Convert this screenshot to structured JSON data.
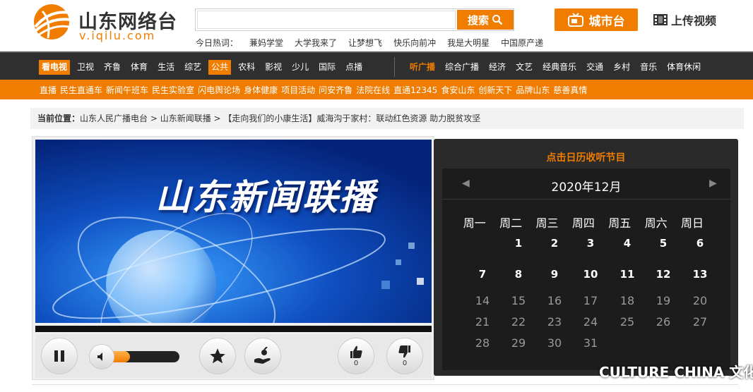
{
  "header": {
    "logo_title": "山东网络台",
    "logo_url": "v.iqilu.com",
    "search_placeholder": "",
    "search_label": "搜索",
    "hot_label": "今日热词：",
    "hot_words": [
      "蒹妈学堂",
      "大学我来了",
      "让梦想飞",
      "快乐向前冲",
      "我是大明星",
      "中国原产递"
    ],
    "city_label": "城市台",
    "upload_label": "上传视频"
  },
  "nav": {
    "tv_label": "看电视",
    "tv_items": [
      "卫视",
      "齐鲁",
      "体育",
      "生活",
      "综艺",
      "公共",
      "农科",
      "影视",
      "少儿",
      "国际",
      "点播"
    ],
    "radio_label": "听广播",
    "radio_items": [
      "综合广播",
      "经济",
      "文艺",
      "经典音乐",
      "交通",
      "乡村",
      "音乐",
      "体育休闲"
    ]
  },
  "subnav": {
    "items": [
      "直播",
      "民生直通车",
      "新闻午班车",
      "民生实验室",
      "闪电舆论场",
      "身体健康",
      "项目活动",
      "问安齐鲁",
      "法院在线",
      "直通12345",
      "食安山东",
      "创新天下",
      "品牌山东",
      "慈善真情"
    ]
  },
  "breadcrumb": {
    "label": "当前位置：",
    "path": "山东人民广播电台 > 山东新闻联播 > 【走向我们的小康生活】威海沟于家村：联动红色资源 助力脱贫攻坚"
  },
  "player": {
    "video_title": "山东新闻联播",
    "volume": 0.3,
    "likes": "0",
    "dislikes": "0"
  },
  "calendar": {
    "heading": "点击日历收听节目",
    "month": "2020年12月",
    "weekdays": [
      "周一",
      "周二",
      "周三",
      "周四",
      "周五",
      "周六",
      "周日"
    ],
    "days_active": [
      "1",
      "2",
      "3",
      "4",
      "5",
      "6",
      "7",
      "8",
      "9",
      "10",
      "11",
      "12",
      "13"
    ],
    "days_inactive": [
      "14",
      "15",
      "16",
      "17",
      "18",
      "19",
      "20",
      "21",
      "22",
      "23",
      "24",
      "25",
      "26",
      "27",
      "28",
      "29",
      "30",
      "31"
    ]
  },
  "watermark": "CULTURE CHINA 文化视界",
  "colors": {
    "accent": "#f07c00",
    "nav_bg": "#2f2f2f",
    "calendar_bg": "#2a2a2a"
  }
}
